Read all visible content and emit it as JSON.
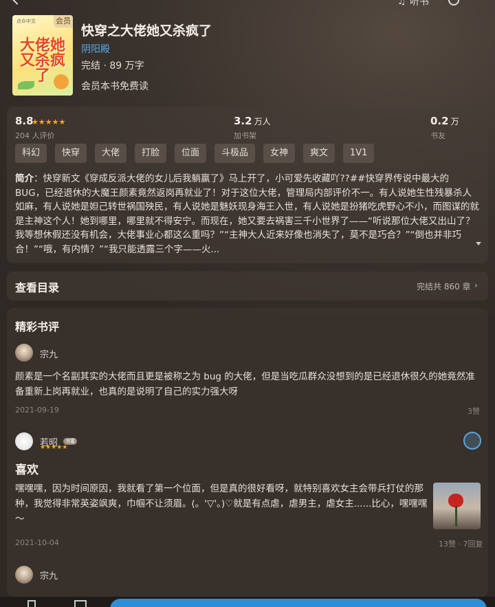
{
  "header": {
    "listen_label": "听书",
    "back_icon": "chevron-left-icon",
    "listen_icon": "headphones-icon",
    "more_icon": "more-icon"
  },
  "book": {
    "vip_badge": "会员",
    "cover_publisher": "点众中文",
    "cover_title": "大佬她又杀疯了",
    "title": "快穿之大佬她又杀疯了",
    "author": "阴阳殿",
    "status": "完结 · 89 万字",
    "vip_free": "会员本书免费读"
  },
  "stats": {
    "rating": "8.8",
    "rating_label": "204 人评价",
    "stars": "★★★★★",
    "shelf_value": "3.2",
    "shelf_unit": "万人",
    "shelf_label": "加书架",
    "friends_value": "0.2",
    "friends_unit": "万",
    "friends_label": "书友"
  },
  "tags": [
    "科幻",
    "快穿",
    "大佬",
    "打脸",
    "位面",
    "斗极品",
    "女神",
    "爽文",
    "1V1"
  ],
  "intro": {
    "label": "简介",
    "text": "：快穿新文《穿成反派大佬的女儿后我躺赢了》马上开了，小可爱先收藏吖??##快穿界传说中最大的 BUG，已经退休的大魔王颜素竟然返岗再就业了！对于这位大佬，管理局内部评价不一。有人说她生性残暴杀人如麻，有人说她是妲己转世祸国殃民，有人说她是魅妖现身海王入世，有人说她是扮猪吃虎野心不小，而图谋的就是主神这个人！她到哪里，哪里就不得安宁。而现在，她又要去祸害三千小世界了——“听说那位大佬又出山了？我等想休假还没有机会，大佬事业心都这么重吗？”“主神大人近来好像也消失了，莫不是巧合？”“倒也并非巧合！”“哦，有内情？”“我只能透露三个字——火..."
  },
  "toc": {
    "title": "查看目录",
    "count": "完结共 860 章",
    "chevron": "›"
  },
  "reviews_section": {
    "title": "精彩书评",
    "reviews": [
      {
        "user": "宗九",
        "text": "颜素是一个名副其实的大佬而且更是被称之为 bug 的大佬，但是当吃瓜群众没想到的是已经退休很久的她竟然准备重新上岗再就业，也真的是说明了自己的实力强大呀",
        "date": "2021-09-19",
        "meta": "3赞"
      },
      {
        "user": "若昭",
        "level": "书童",
        "stars": "★★★★★",
        "heading": "喜欢",
        "text": "嘿嘿嘿，因为时间原因，我就看了第一个位面，但是真的很好看呀，就特别喜欢女主会带兵打仗的那种，我觉得非常英姿飒爽，巾帼不让须眉。(。'▽'。)♡就是有点虐，虐男主，虐女主......比心，嘿嘿嘿～",
        "date": "2021-10-04",
        "meta": "13赞 · 7回复"
      },
      {
        "user": "宗九"
      }
    ]
  }
}
